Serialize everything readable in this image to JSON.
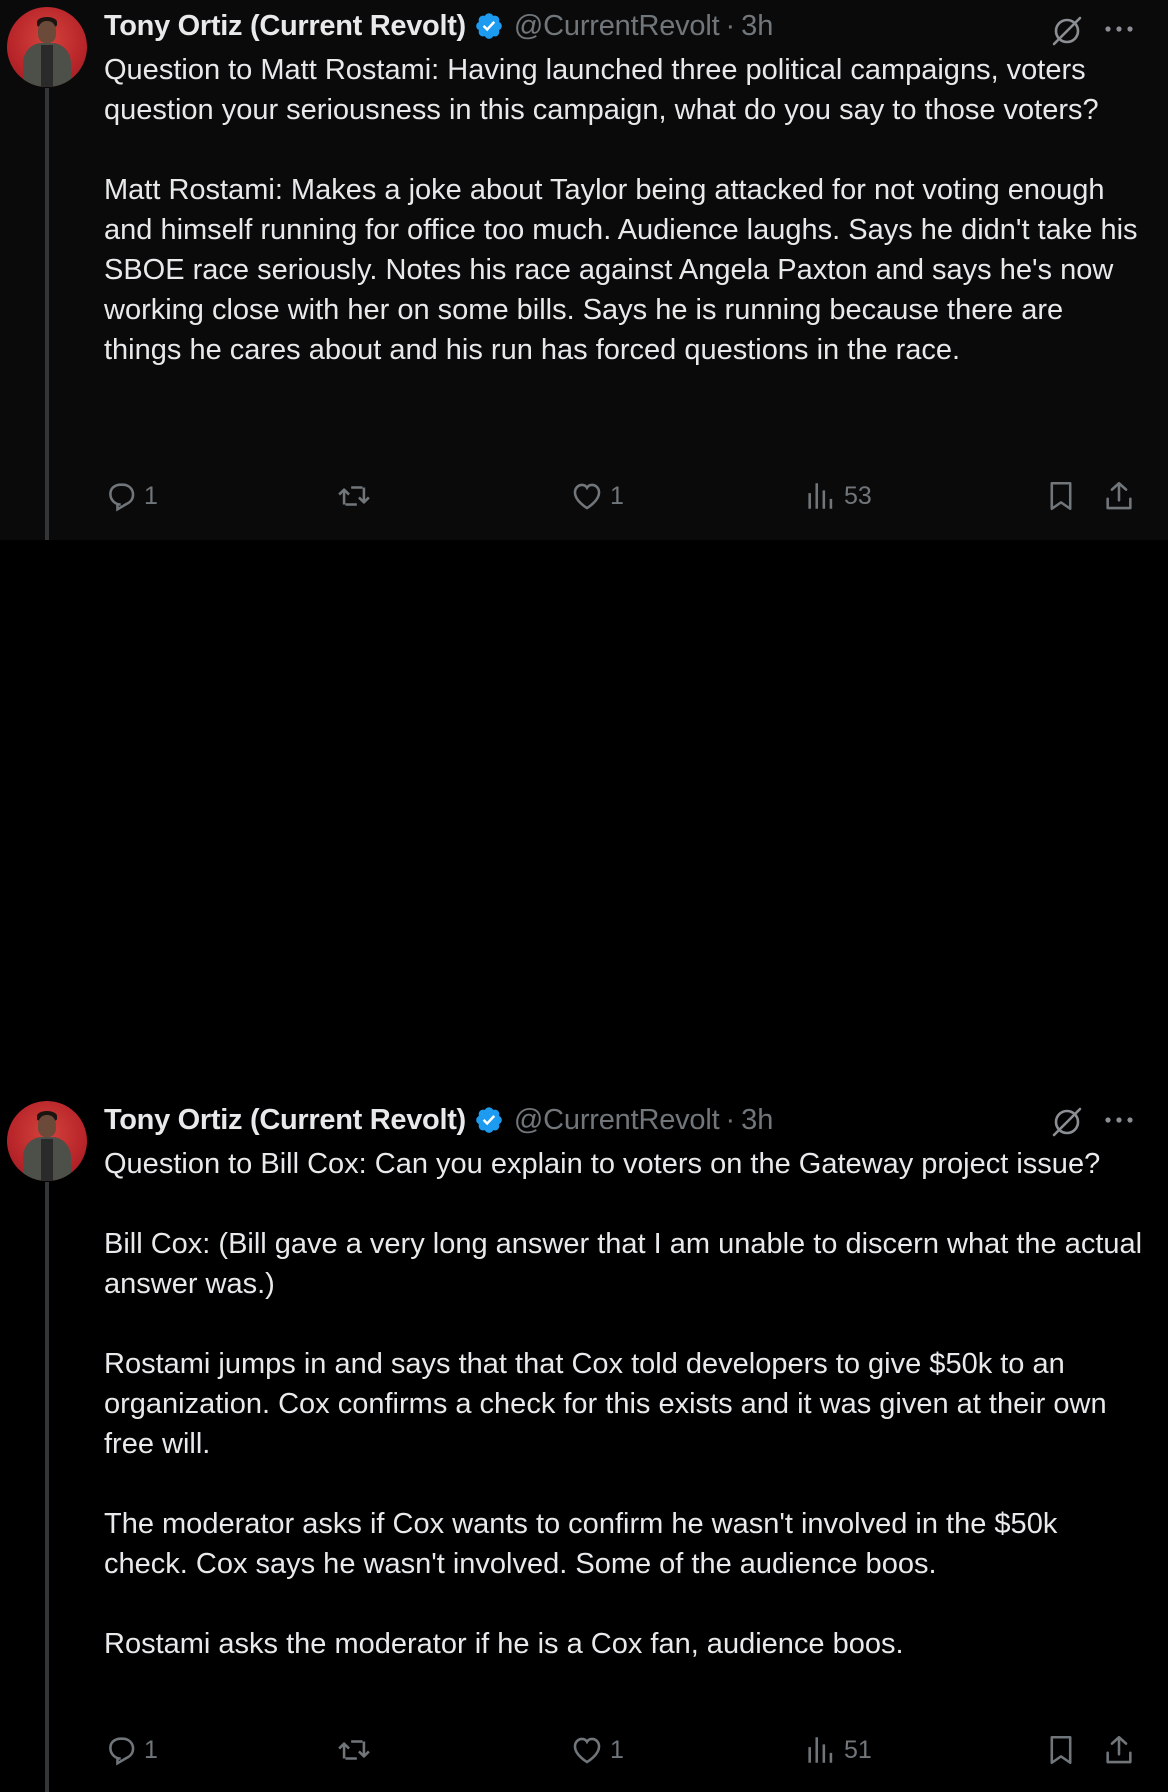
{
  "tweets": [
    {
      "author_name": "Tony Ortiz (Current Revolt)",
      "handle": "@CurrentRevolt",
      "separator": "·",
      "time": "3h",
      "text": "Question to Matt Rostami: Having launched three political campaigns, voters question your seriousness in this campaign, what do you say to those voters?\n\nMatt Rostami: Makes a joke about Taylor being attacked for not voting enough and himself running for office too much. Audience laughs. Says he didn't take his SBOE race seriously. Notes his race against Angela Paxton and says he's now working close with her on some bills. Says he is running because there are things he cares about and his run has forced questions in the race.",
      "replies": "1",
      "retweets": "",
      "likes": "1",
      "views": "53"
    },
    {
      "author_name": "Tony Ortiz (Current Revolt)",
      "handle": "@CurrentRevolt",
      "separator": "·",
      "time": "3h",
      "text": "Question to Bill Cox: Can you explain to voters on the Gateway project issue?\n\nBill Cox: (Bill gave a very long answer that I am unable to discern what the actual answer was.)\n\nRostami jumps in and says that that Cox told developers to give $50k to an organization. Cox confirms a check for this exists and it was given at their own free will.\n\nThe moderator asks if Cox wants to confirm he wasn't involved in the $50k check. Cox says he wasn't involved. Some of the audience boos.\n\nRostami asks the moderator if he is a Cox fan, audience boos.",
      "replies": "1",
      "retweets": "",
      "likes": "1",
      "views": "51"
    }
  ],
  "icons": {
    "verified": "verified-badge-icon",
    "grok": "grok-icon",
    "more": "more-icon",
    "reply": "reply-icon",
    "retweet": "retweet-icon",
    "like": "heart-icon",
    "views": "views-icon",
    "bookmark": "bookmark-icon",
    "share": "share-icon"
  },
  "colors": {
    "background": "#000000",
    "text": "#e7e9ea",
    "secondary": "#71767b",
    "verified": "#1d9bf0"
  }
}
